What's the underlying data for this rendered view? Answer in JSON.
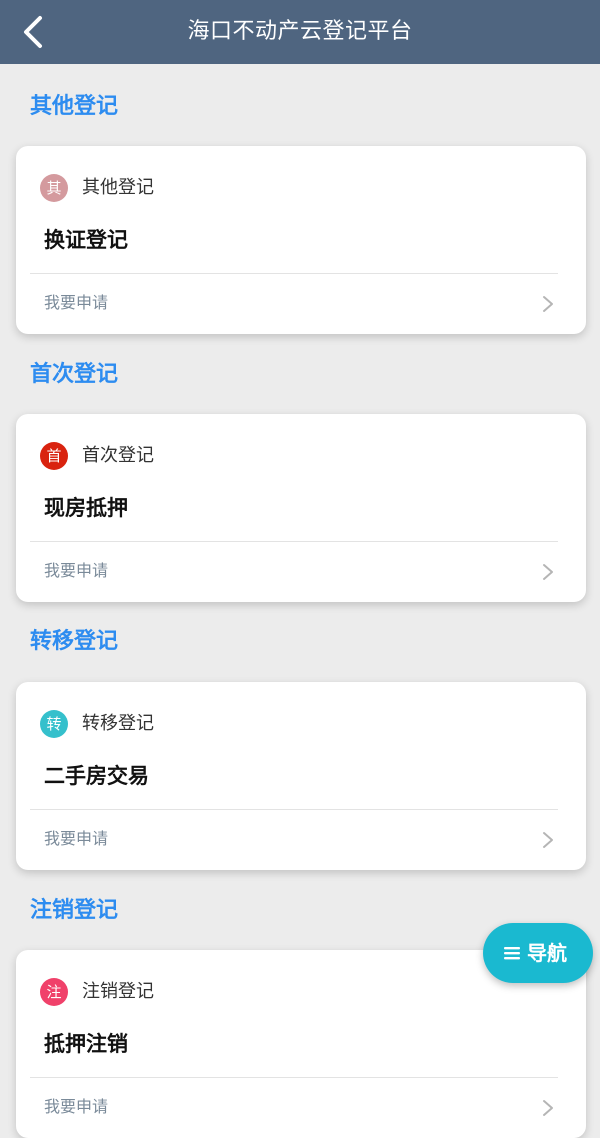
{
  "header": {
    "title": "海口不动产云登记平台",
    "back_icon": "chevron-left-icon"
  },
  "sections": [
    {
      "heading": "其他登记",
      "card": {
        "badge_char": "其",
        "badge_color": "#d49a9e",
        "category": "其他登记",
        "title": "换证登记",
        "action_label": "我要申请"
      }
    },
    {
      "heading": "首次登记",
      "card": {
        "badge_char": "首",
        "badge_color": "#d9230f",
        "category": "首次登记",
        "title": "现房抵押",
        "action_label": "我要申请"
      }
    },
    {
      "heading": "转移登记",
      "card": {
        "badge_char": "转",
        "badge_color": "#35c0cc",
        "category": "转移登记",
        "title": "二手房交易",
        "action_label": "我要申请"
      }
    },
    {
      "heading": "注销登记",
      "card": {
        "badge_char": "注",
        "badge_color": "#f0416a",
        "category": "注销登记",
        "title": "抵押注销",
        "action_label": "我要申请"
      }
    }
  ],
  "fab": {
    "label": "导航",
    "icon": "menu-icon"
  },
  "colors": {
    "header_bg": "#4f6580",
    "section_heading": "#2d8cf0",
    "fab_bg": "#1ab9d0"
  }
}
